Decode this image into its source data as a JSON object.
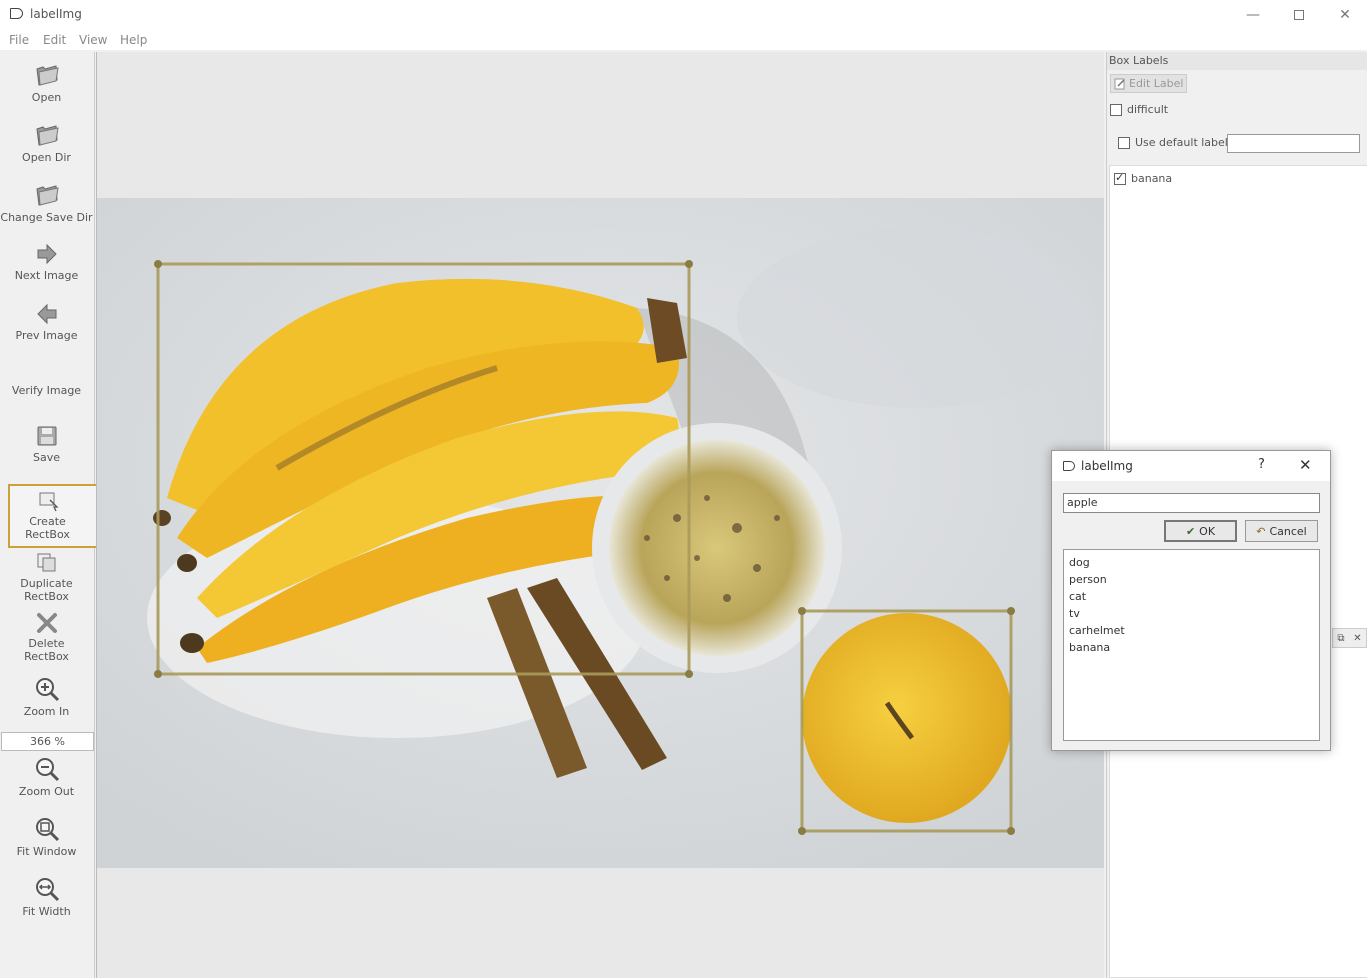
{
  "window": {
    "title": "labelImg",
    "controls": {
      "minimize": "—",
      "close": "✕"
    }
  },
  "menu": [
    "File",
    "Edit",
    "View",
    "Help"
  ],
  "toolbar": {
    "tools": [
      {
        "name": "open",
        "label": "Open",
        "icon": "folder-icon"
      },
      {
        "name": "open-dir",
        "label": "Open Dir",
        "icon": "folder-icon"
      },
      {
        "name": "change-save-dir",
        "label": "Change Save Dir",
        "icon": "folder-icon"
      },
      {
        "name": "next-image",
        "label": "Next Image",
        "icon": "arrow-right-icon"
      },
      {
        "name": "prev-image",
        "label": "Prev Image",
        "icon": "arrow-left-icon"
      },
      {
        "name": "verify-image",
        "label": "Verify Image",
        "icon": ""
      },
      {
        "name": "save",
        "label": "Save",
        "icon": "save-icon"
      },
      {
        "name": "create-rectbox",
        "label": "Create\nRectBox",
        "icon": "create-rectbox-icon"
      },
      {
        "name": "duplicate-rectbox",
        "label": "Duplicate\nRectBox",
        "icon": "duplicate-icon"
      },
      {
        "name": "delete-rectbox",
        "label": "Delete\nRectBox",
        "icon": "delete-icon"
      },
      {
        "name": "zoom-in",
        "label": "Zoom In",
        "icon": "zoom-in-icon"
      },
      {
        "name": "zoom-out",
        "label": "Zoom Out",
        "icon": "zoom-out-icon"
      },
      {
        "name": "fit-window",
        "label": "Fit Window",
        "icon": "fit-window-icon"
      },
      {
        "name": "fit-width",
        "label": "Fit Width",
        "icon": "fit-width-icon"
      }
    ],
    "zoom_value": "366 %"
  },
  "dock": {
    "title": "Box Labels",
    "edit_label": "Edit Label",
    "difficult_label": "difficult",
    "use_default_label": "Use default label",
    "default_label_value": "",
    "labels": [
      {
        "text": "banana",
        "checked": true
      }
    ]
  },
  "dialog": {
    "title": "labelImg",
    "help": "?",
    "close": "✕",
    "input_value": "apple",
    "ok_label": "OK",
    "cancel_label": "Cancel",
    "options": [
      "dog",
      "person",
      "cat",
      "tv",
      "carhelmet",
      "banana"
    ]
  },
  "colors": {
    "box_outline": "#a89a5a",
    "active_tool_border": "#c9a33a",
    "banana_yellow": "#f2c02a"
  }
}
